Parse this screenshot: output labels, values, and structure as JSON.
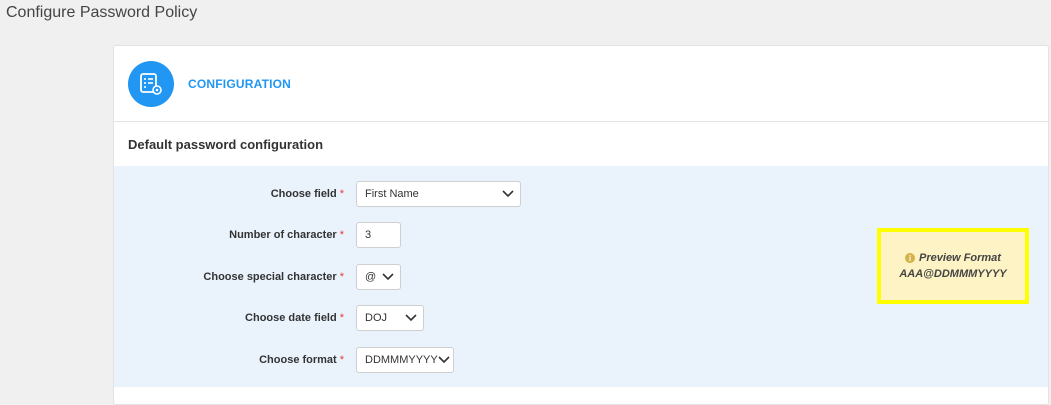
{
  "page": {
    "title": "Configure Password Policy"
  },
  "card": {
    "header_title": "CONFIGURATION",
    "header_icon": "settings-list-icon",
    "section_title": "Default password configuration"
  },
  "form": {
    "choose_field": {
      "label": "Choose field",
      "value": "First Name"
    },
    "num_chars": {
      "label": "Number of character",
      "value": "3"
    },
    "special_char": {
      "label": "Choose special character",
      "value": "@"
    },
    "date_field": {
      "label": "Choose date field",
      "value": "DOJ"
    },
    "format": {
      "label": "Choose format",
      "value": "DDMMMYYYY"
    },
    "required_marker": "*"
  },
  "preview": {
    "title": "Preview Format",
    "value": "AAA@DDMMMYYYY",
    "icon": "info-icon"
  },
  "colors": {
    "accent": "#2196f3",
    "required": "#e53935",
    "preview_bg": "#fdf3c4",
    "preview_border": "#ffff00"
  }
}
